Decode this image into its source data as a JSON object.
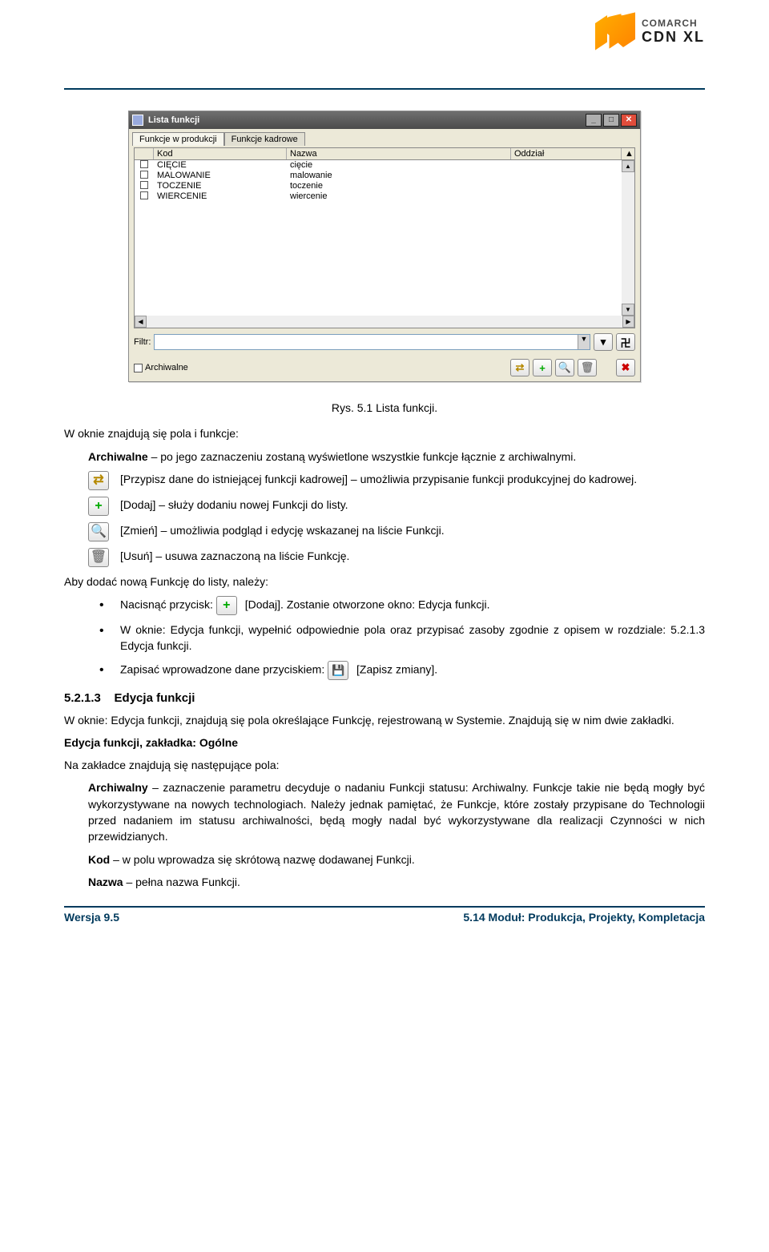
{
  "brand": {
    "name": "COMARCH",
    "product": "CDN XL"
  },
  "window": {
    "title": "Lista funkcji",
    "tabs": [
      "Funkcje w produkcji",
      "Funkcje kadrowe"
    ],
    "columns": {
      "kod": "Kod",
      "nazwa": "Nazwa",
      "oddzial": "Oddział"
    },
    "rows": [
      {
        "kod": "CIĘCIE",
        "nazwa": "cięcie",
        "oddzial": ""
      },
      {
        "kod": "MALOWANIE",
        "nazwa": "malowanie",
        "oddzial": ""
      },
      {
        "kod": "TOCZENIE",
        "nazwa": "toczenie",
        "oddzial": ""
      },
      {
        "kod": "WIERCENIE",
        "nazwa": "wiercenie",
        "oddzial": ""
      }
    ],
    "filter_label": "Filtr:",
    "archive_label": "Archiwalne",
    "icons": {
      "assign": "⇄",
      "add": "+",
      "zoom": "🔍",
      "funnel": "▾",
      "trash": "🗑",
      "close": "✖"
    }
  },
  "caption": "Rys. 5.1 Lista funkcji.",
  "body": {
    "intro": "W oknie znajdują się pola i funkcje:",
    "archiwalne": "Archiwalne – po jego zaznaczeniu zostaną wyświetlone wszystkie funkcje łącznie z archiwalnymi.",
    "btn_assign": "[Przypisz dane do istniejącej funkcji kadrowej] – umożliwia przypisanie funkcji produkcyjnej do kadrowej.",
    "btn_add": "[Dodaj] – służy dodaniu nowej Funkcji do listy.",
    "btn_edit": "[Zmień] – umożliwia podgląd i edycję wskazanej na liście Funkcji.",
    "btn_del": "[Usuń] – usuwa zaznaczoną na liście Funkcję.",
    "add_intro": "Aby dodać nową Funkcję do listy, należy:",
    "bullet1a": "Nacisnąć przycisk: ",
    "bullet1b": " [Dodaj]. Zostanie otworzone okno: Edycja funkcji.",
    "bullet2": "W oknie: Edycja funkcji, wypełnić odpowiednie pola oraz przypisać zasoby zgodnie z opisem w rozdziale: 5.2.1.3 Edycja funkcji.",
    "bullet3a": "Zapisać wprowadzone dane przyciskiem: ",
    "bullet3b": " [Zapisz zmiany].",
    "h_num": "5.2.1.3",
    "h_title": "Edycja funkcji",
    "sec_intro": "W oknie: Edycja funkcji, znajdują się pola określające Funkcję, rejestrowaną w Systemie. Znajdują się w nim dwie zakładki.",
    "sub_title": "Edycja funkcji, zakładka: Ogólne",
    "sub_intro": "Na zakładce znajdują się następujące pola:",
    "archiwalny": "Archiwalny – zaznaczenie parametru decyduje o nadaniu Funkcji statusu: Archiwalny. Funkcje takie nie będą mogły być wykorzystywane na nowych technologiach. Należy jednak pamiętać, że Funkcje, które zostały przypisane do Technologii przed nadaniem im statusu archiwalności, będą mogły nadal być wykorzystywane dla realizacji Czynności w nich przewidzianych.",
    "kod": "Kod – w polu wprowadza się skrótową nazwę dodawanej Funkcji.",
    "nazwa": "Nazwa – pełna nazwa Funkcji."
  },
  "footer": {
    "left": "Wersja 9.5",
    "right": "5.14 Moduł: Produkcja, Projekty, Kompletacja"
  }
}
